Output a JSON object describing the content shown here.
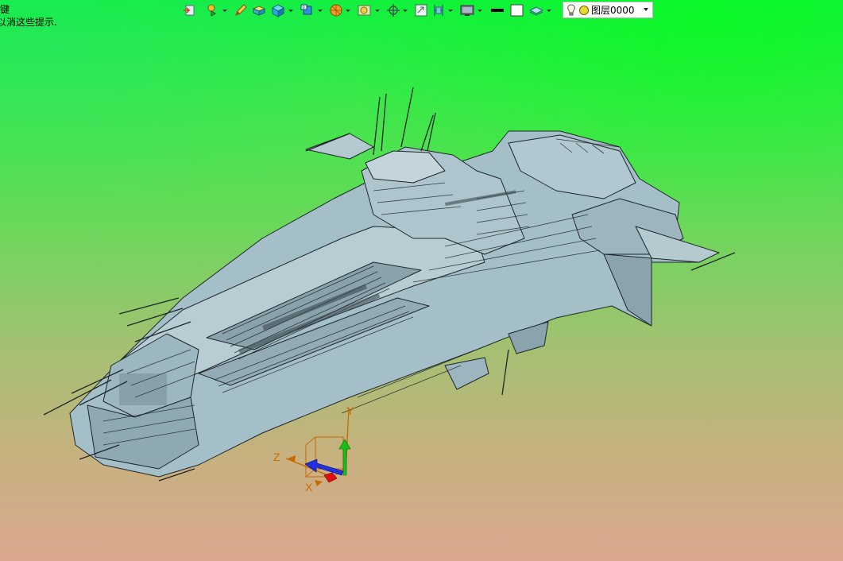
{
  "hint": {
    "line1": "键",
    "line2": "以消这些提示."
  },
  "toolbar": {
    "icons": [
      "import-icon",
      "snap-icon",
      "pencil-icon",
      "box-icon",
      "solid-cube-icon",
      "view-cube-icon",
      "sphere-render-icon",
      "shade-icon",
      "rotate-view-icon",
      "fit-view-icon",
      "section-view-icon",
      "display-mode-icon",
      "line-weight-icon",
      "color-swatch-icon",
      "layer-manager-icon"
    ]
  },
  "layer": {
    "name": "图层0000",
    "light_icon": "lightbulb-icon",
    "color_icon": "layer-color-icon",
    "color": "#e8d830"
  },
  "triad": {
    "x": "X",
    "y": "Y",
    "z": "Z",
    "colors": {
      "x": "#e01010",
      "y": "#18c018",
      "z": "#2030e0",
      "label": "#c86a00"
    }
  },
  "model": {
    "fill": "#a5bfc8",
    "stroke": "#1e2628"
  }
}
